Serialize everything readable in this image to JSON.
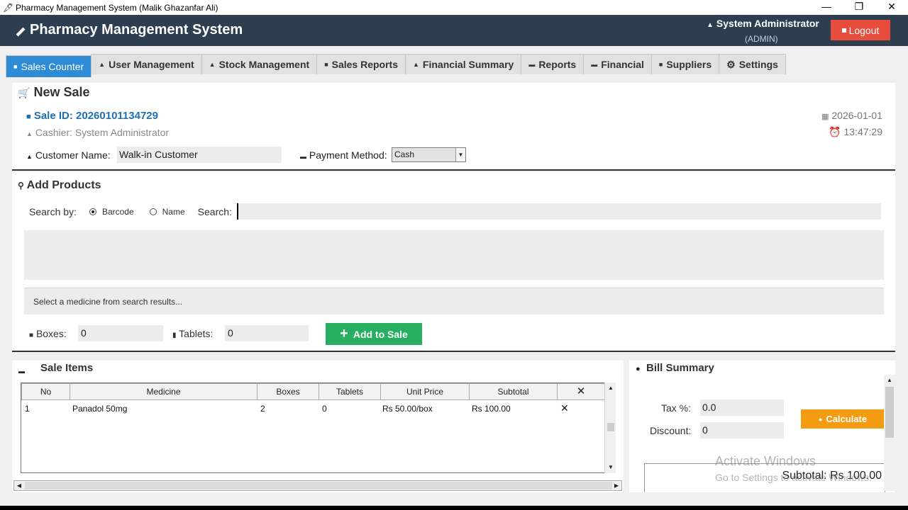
{
  "window": {
    "title": "Pharmacy Management System (Malik Ghazanfar Ali)",
    "minimize": "—",
    "restore": "❐",
    "close": "✕"
  },
  "header": {
    "app_title": "Pharmacy Management System",
    "user_name": "System Administrator",
    "user_role": "(ADMIN)",
    "logout_label": "Logout"
  },
  "tabs": [
    {
      "label": "Sales Counter",
      "active": true
    },
    {
      "label": "User Management"
    },
    {
      "label": "Stock Management"
    },
    {
      "label": "Sales Reports"
    },
    {
      "label": "Financial Summary"
    },
    {
      "label": "Reports"
    },
    {
      "label": "Financial"
    },
    {
      "label": "Suppliers"
    },
    {
      "label": "Settings"
    }
  ],
  "new_sale": {
    "heading": "New Sale",
    "sale_id": "Sale ID: 20260101134729",
    "cashier": "Cashier: System Administrator",
    "date": "2026-01-01",
    "time": "13:47:29",
    "customer_label": "Customer Name:",
    "customer_value": "Walk-in Customer",
    "payment_label": "Payment Method:",
    "payment_value": "Cash"
  },
  "add_products": {
    "heading": "Add Products",
    "search_by_label": "Search by:",
    "option_barcode": "Barcode",
    "option_name": "Name",
    "selected_option": "Barcode",
    "search_label": "Search:",
    "search_value": "",
    "detail_text": "Select a medicine from search results...",
    "boxes_label": "Boxes:",
    "boxes_value": "0",
    "tablets_label": "Tablets:",
    "tablets_value": "0",
    "add_button": "Add to Sale"
  },
  "sale_items": {
    "heading": "Sale Items",
    "columns": [
      "No",
      "Medicine",
      "Boxes",
      "Tablets",
      "Unit Price",
      "Subtotal",
      "✕"
    ],
    "rows": [
      {
        "no": "1",
        "medicine": "Panadol 50mg",
        "boxes": "2",
        "tablets": "0",
        "unit_price": "Rs 50.00/box",
        "subtotal": "Rs 100.00",
        "remove": "✕"
      }
    ]
  },
  "bill_summary": {
    "heading": "Bill Summary",
    "tax_label": "Tax %:",
    "tax_value": "0.0",
    "discount_label": "Discount:",
    "discount_value": "0",
    "calculate_label": "Calculate",
    "subtotal_text": "Subtotal: Rs 100.00"
  },
  "watermark": {
    "line1": "Activate Windows",
    "line2": "Go to Settings to activate Windows."
  },
  "colors": {
    "header_bg": "#2c3e50",
    "active_tab": "#2e8bd6",
    "logout": "#e74c3c",
    "add_button": "#27ae60",
    "calculate": "#f39c12",
    "sale_id": "#1f6fb5"
  }
}
